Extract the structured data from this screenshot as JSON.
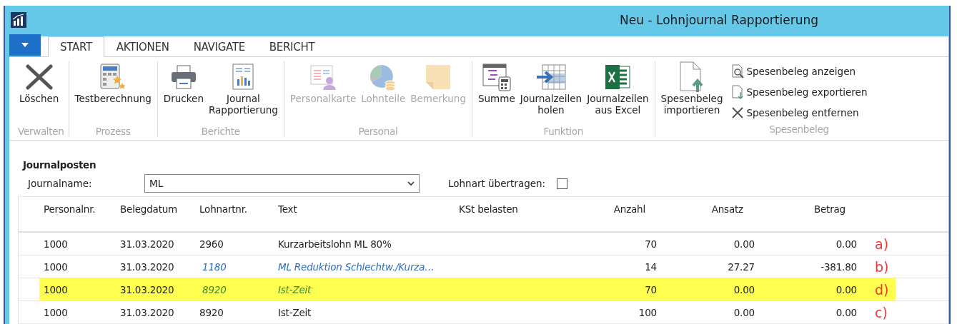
{
  "window": {
    "title": "Neu - Lohnjournal Rapportierung"
  },
  "tabs": [
    {
      "label": "START",
      "selected": true
    },
    {
      "label": "AKTIONEN",
      "selected": false
    },
    {
      "label": "NAVIGATE",
      "selected": false
    },
    {
      "label": "BERICHT",
      "selected": false
    }
  ],
  "ribbon": {
    "groups": [
      {
        "label": "Verwalten",
        "buttons": [
          {
            "label": "Löschen",
            "disabled": false
          }
        ]
      },
      {
        "label": "Prozess",
        "buttons": [
          {
            "label": "Testberechnung",
            "disabled": false
          }
        ]
      },
      {
        "label": "Berichte",
        "buttons": [
          {
            "label": "Drucken",
            "disabled": false
          },
          {
            "label": "Journal Rapportierung",
            "disabled": false
          }
        ]
      },
      {
        "label": "Personal",
        "buttons": [
          {
            "label": "Personalkarte",
            "disabled": true
          },
          {
            "label": "Lohnteile",
            "disabled": true
          },
          {
            "label": "Bemerkung",
            "disabled": true
          }
        ]
      },
      {
        "label": "Funktion",
        "buttons": [
          {
            "label": "Summe",
            "disabled": false
          },
          {
            "label": "Journalzeilen holen",
            "disabled": false
          },
          {
            "label": "Journalzeilen aus Excel",
            "disabled": false
          }
        ]
      },
      {
        "label": "Spesenbeleg",
        "buttons": [
          {
            "label": "Spesenbeleg importieren",
            "disabled": false
          }
        ],
        "small_buttons": [
          {
            "label": "Spesenbeleg anzeigen"
          },
          {
            "label": "Spesenbeleg exportieren"
          },
          {
            "label": "Spesenbeleg entfernen"
          }
        ]
      }
    ]
  },
  "form": {
    "section_title": "Journalposten",
    "journal_name": {
      "label": "Journalname:",
      "value": "ML"
    },
    "transfer": {
      "label": "Lohnart übertragen:",
      "checked": false
    }
  },
  "table": {
    "columns": [
      "Personalnr.",
      "Belegdatum",
      "Lohnartnr.",
      "Text",
      "KSt belasten",
      "Anzahl",
      "Ansatz",
      "Betrag"
    ],
    "rows": [
      {
        "kind": "plain",
        "cells": [
          "1000",
          "31.03.2020",
          "2960",
          "Kurzarbeitslohn ML 80%",
          "",
          "70",
          "0.00",
          "0.00"
        ],
        "annotation": "a)"
      },
      {
        "kind": "link",
        "cells": [
          "1000",
          "31.03.2020",
          "1180",
          "ML Reduktion Schlechtw./Kurza…",
          "",
          "14",
          "27.27",
          "-381.80"
        ],
        "annotation": "b)"
      },
      {
        "kind": "highlighted",
        "cells": [
          "1000",
          "31.03.2020",
          "8920",
          "Ist-Zeit",
          "",
          "70",
          "0.00",
          "0.00"
        ],
        "annotation": "d)"
      },
      {
        "kind": "plain",
        "cells": [
          "1000",
          "31.03.2020",
          "8920",
          "Ist-Zeit",
          "",
          "100",
          "0.00",
          "0.00"
        ],
        "annotation": "c)"
      }
    ]
  }
}
